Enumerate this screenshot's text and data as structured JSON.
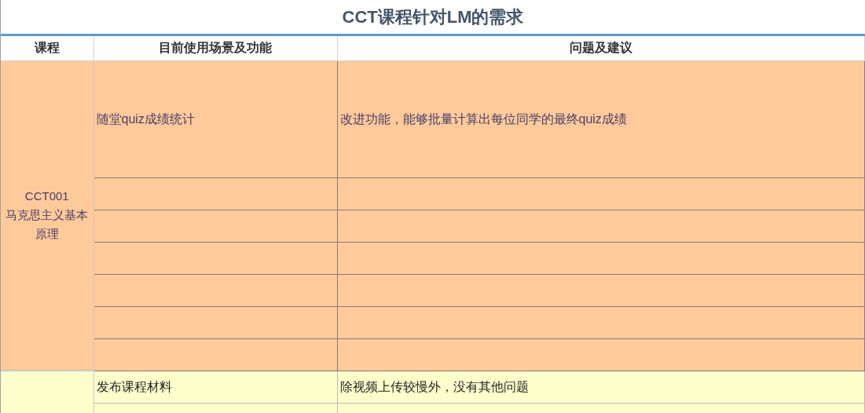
{
  "title": "CCT课程针对LM的需求",
  "columns": [
    "课程",
    "目前使用场景及功能",
    "问题及建议"
  ],
  "groups": [
    {
      "color": "#ffca99",
      "course_code": "CCT001",
      "course_name": "马克思主义基本原理",
      "rows": [
        {
          "kind": "tall",
          "scenario": "随堂quiz成绩统计",
          "suggestion": "改进功能，能够批量计算出每位同学的最终quiz成绩"
        },
        {
          "kind": "normal"
        },
        {
          "kind": "normal"
        },
        {
          "kind": "normal"
        },
        {
          "kind": "normal"
        },
        {
          "kind": "normal"
        },
        {
          "kind": "normal"
        }
      ]
    },
    {
      "color": "#ffffcc",
      "rows": [
        {
          "kind": "normal",
          "scenario": "发布课程材料",
          "suggestion": "除视频上传较慢外，没有其他问题"
        },
        {
          "kind": "normal"
        }
      ]
    }
  ]
}
